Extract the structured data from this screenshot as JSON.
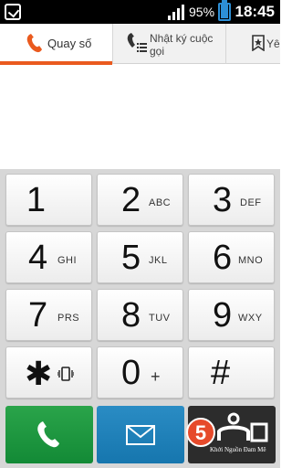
{
  "status_bar": {
    "battery_percent": "95%",
    "time": "18:45",
    "battery_level": 0.95
  },
  "tabs": [
    {
      "label": "Quay số",
      "icon": "phone-icon",
      "active": true
    },
    {
      "label": "Nhật ký cuộc gọi",
      "icon": "call-log-icon",
      "active": false
    },
    {
      "label": "Yêu",
      "icon": "favorites-icon",
      "active": false
    }
  ],
  "display": {
    "number": ""
  },
  "keypad": [
    {
      "digit": "1",
      "letters": ""
    },
    {
      "digit": "2",
      "letters": "ABC"
    },
    {
      "digit": "3",
      "letters": "DEF"
    },
    {
      "digit": "4",
      "letters": "GHI"
    },
    {
      "digit": "5",
      "letters": "JKL"
    },
    {
      "digit": "6",
      "letters": "MNO"
    },
    {
      "digit": "7",
      "letters": "PRS"
    },
    {
      "digit": "8",
      "letters": "TUV"
    },
    {
      "digit": "9",
      "letters": "WXY"
    },
    {
      "digit": "✱",
      "letters": "",
      "icon": "vibrate-icon"
    },
    {
      "digit": "0",
      "letters": "+"
    },
    {
      "digit": "#",
      "letters": ""
    }
  ],
  "actions": {
    "call_icon": "phone-icon",
    "message_icon": "envelope-icon",
    "more_icon": "menu-icon",
    "watermark_number": "5",
    "watermark_text": "Khởi Nguồn Đam Mê"
  },
  "colors": {
    "accent": "#ea5a1e",
    "call": "#1f9a40",
    "message": "#1f82ba",
    "status_bar": "#000000",
    "battery": "#2d8fd6"
  }
}
